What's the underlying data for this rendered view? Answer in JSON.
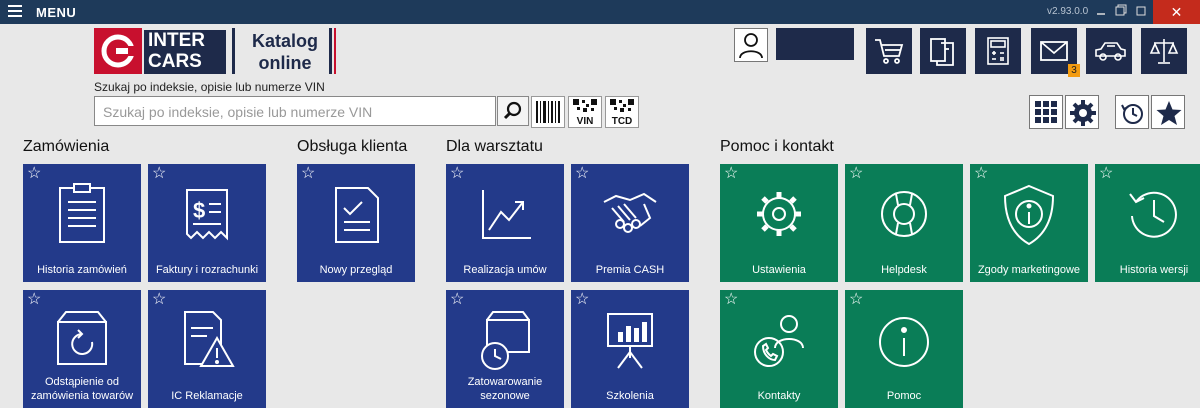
{
  "titlebar": {
    "menu_label": "MENU",
    "version": "v2.93.0.0"
  },
  "logo": {
    "line1": "INTER",
    "line2": "CARS"
  },
  "catalog": {
    "line1": "Katalog",
    "line2": "online"
  },
  "search": {
    "label": "Szukaj po indeksie, opisie lub numerze VIN",
    "placeholder": "Szukaj po indeksie, opisie lub numerze VIN",
    "value": ""
  },
  "scan_buttons": {
    "vin_label": "VIN",
    "tcd_label": "TCD"
  },
  "toolbar": {
    "mail_badge": "3"
  },
  "sections": {
    "orders": "Zamówienia",
    "service": "Obsługa klienta",
    "workshop": "Dla warsztatu",
    "help": "Pomoc i kontakt"
  },
  "tiles": {
    "order_history": "Historia zamówień",
    "invoices": "Faktury i rozrachunki",
    "returns_l1": "Odstąpienie od",
    "returns_l2": "zamówienia towarów",
    "complaints": "IC Reklamacje",
    "new_inspection": "Nowy przegląd",
    "contracts": "Realizacja umów",
    "premium": "Premia CASH",
    "seasonal_l1": "Zatowarowanie",
    "seasonal_l2": "sezonowe",
    "training": "Szkolenia",
    "settings": "Ustawienia",
    "helpdesk": "Helpdesk",
    "consents": "Zgody marketingowe",
    "version_history": "Historia wersji",
    "contacts": "Kontakty",
    "help": "Pomoc"
  },
  "icons": {
    "tile_star": "☆",
    "window_close": "✕"
  }
}
